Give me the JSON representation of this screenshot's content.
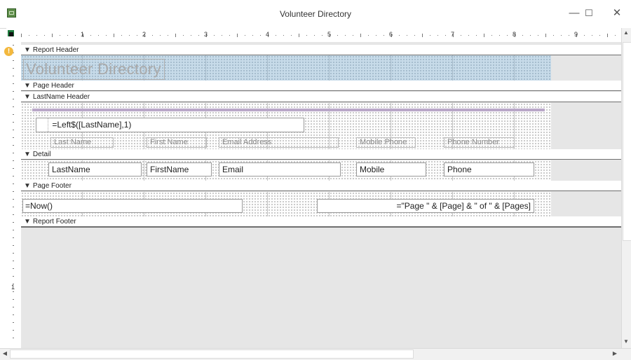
{
  "window": {
    "title": "Volunteer Directory",
    "minimize_glyph": "—",
    "maximize_glyph": "☐",
    "close_glyph": "✕"
  },
  "ruler": {
    "top_numbers": [
      "1",
      "2",
      "3",
      "4",
      "5",
      "6",
      "7",
      "8",
      "9"
    ],
    "left_numbers": [
      "1"
    ]
  },
  "sections": {
    "report_header": "Report Header",
    "page_header": "Page Header",
    "lastname_header": "LastName Header",
    "detail": "Detail",
    "page_footer": "Page Footer",
    "report_footer": "Report Footer"
  },
  "controls": {
    "report_title": "Volunteer Directory",
    "group_expression": "=Left$([LastName],1)",
    "labels": {
      "last_name": "Last Name",
      "first_name": "First Name",
      "email": "Email Address",
      "mobile": "Mobile Phone",
      "phone": "Phone Number"
    },
    "fields": {
      "last_name": "LastName",
      "first_name": "FirstName",
      "email": "Email",
      "mobile": "Mobile",
      "phone": "Phone"
    },
    "footer_date": "=Now()",
    "footer_page": "=\"Page \" & [Page] & \" of \" & [Pages]"
  },
  "colors": {
    "header_band": "#c7dbe9",
    "group_line": "#b9a7c8",
    "section_bar_border": "#6e6e6e"
  }
}
